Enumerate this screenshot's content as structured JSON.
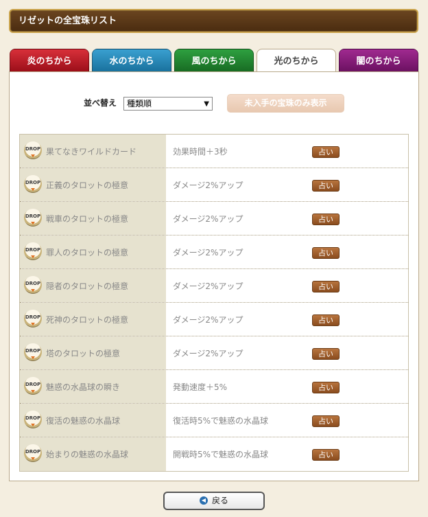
{
  "header": {
    "title": "リゼットの全宝珠リスト"
  },
  "tabs": [
    {
      "label": "炎のちから",
      "active": false,
      "color": "#c41e2c"
    },
    {
      "label": "水のちから",
      "active": false,
      "color": "#2a8ab8"
    },
    {
      "label": "風のちから",
      "active": false,
      "color": "#228a32"
    },
    {
      "label": "光のちから",
      "active": true,
      "color": "#ffffff"
    },
    {
      "label": "闇のちから",
      "active": false,
      "color": "#8a1c78"
    }
  ],
  "controls": {
    "sort_label": "並べ替え",
    "sort_value": "種類順",
    "filter_button": "未入手の宝珠のみ表示"
  },
  "jewels": [
    {
      "badge": "DROP",
      "name": "果てなきワイルドカード",
      "effect": "効果時間＋3秒",
      "action": "占い"
    },
    {
      "badge": "DROP",
      "name": "正義のタロットの極意",
      "effect": "ダメージ2%アップ",
      "action": "占い"
    },
    {
      "badge": "DROP",
      "name": "戦車のタロットの極意",
      "effect": "ダメージ2%アップ",
      "action": "占い"
    },
    {
      "badge": "DROP",
      "name": "罪人のタロットの極意",
      "effect": "ダメージ2%アップ",
      "action": "占い"
    },
    {
      "badge": "DROP",
      "name": "隠者のタロットの極意",
      "effect": "ダメージ2%アップ",
      "action": "占い"
    },
    {
      "badge": "DROP",
      "name": "死神のタロットの極意",
      "effect": "ダメージ2%アップ",
      "action": "占い"
    },
    {
      "badge": "DROP",
      "name": "塔のタロットの極意",
      "effect": "ダメージ2%アップ",
      "action": "占い"
    },
    {
      "badge": "DROP",
      "name": "魅惑の水晶球の瞬き",
      "effect": "発動速度＋5%",
      "action": "占い"
    },
    {
      "badge": "DROP",
      "name": "復活の魅惑の水晶球",
      "effect": "復活時5%で魅惑の水晶球",
      "action": "占い"
    },
    {
      "badge": "DROP",
      "name": "始まりの魅惑の水晶球",
      "effect": "開戦時5%で魅惑の水晶球",
      "action": "占い"
    }
  ],
  "footer": {
    "back_label": "戻る"
  }
}
